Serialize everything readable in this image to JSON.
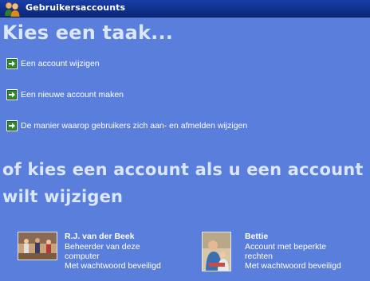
{
  "window": {
    "title": "Gebruikersaccounts",
    "app_icon": "users-icon"
  },
  "tasks_heading": "Kies een taak...",
  "tasks": [
    {
      "label": "Een account wijzigen",
      "icon": "green-arrow-icon"
    },
    {
      "label": "Een nieuwe account maken",
      "icon": "green-arrow-icon"
    },
    {
      "label": "De manier waarop gebruikers zich aan- en afmelden wijzigen",
      "icon": "green-arrow-icon"
    }
  ],
  "accounts_heading": "of kies een account als u een account wilt wijzigen",
  "accounts": [
    {
      "name": "R.J. van der Beek",
      "lines": [
        "Beheerder van deze",
        "computer",
        "Met wachtwoord beveiligd"
      ]
    },
    {
      "name": "Bettie",
      "lines": [
        "Account met beperkte",
        "rechten",
        "Met wachtwoord beveiligd"
      ]
    }
  ],
  "colors": {
    "background": "#5a7edc",
    "titlebar": "#0f2f8c",
    "heading": "#dbe6ff",
    "arrow": "#2d8a2d"
  }
}
